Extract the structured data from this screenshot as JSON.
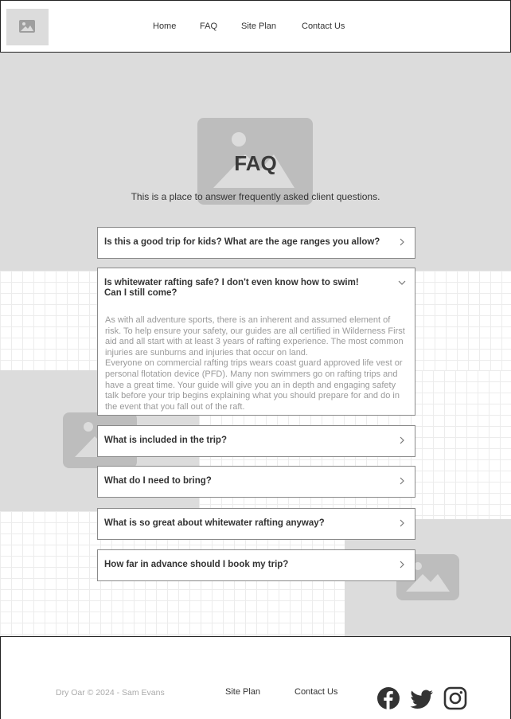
{
  "header": {
    "nav": [
      {
        "label": "Home"
      },
      {
        "label": "FAQ"
      },
      {
        "label": "Site Plan"
      },
      {
        "label": "Contact Us"
      }
    ]
  },
  "hero": {
    "title": "FAQ",
    "subtitle": "This is a place to answer frequently asked client questions."
  },
  "faq": [
    {
      "question": "Is this a good trip for kids? What are the age ranges you allow?",
      "expanded": false
    },
    {
      "question": "Is whitewater rafting safe? I don't even know how to swim! Can I still come?",
      "expanded": true,
      "answer_p1": "As with all adventure sports, there is an inherent and assumed element of risk. To help ensure your safety, our guides are all certified in Wilderness First aid and all start with at least 3 years of rafting experience. The most common injuries are sunburns and injuries that occur on land.",
      "answer_p2": "Everyone on commercial rafting trips wears coast guard approved life vest or personal flotation device (PFD). Many non swimmers go on rafting trips and have a great time. Your guide will give you an in depth and engaging safety talk before your trip begins explaining what you should prepare for and do in the event that you fall out of the raft."
    },
    {
      "question": "What is included in the trip?",
      "expanded": false
    },
    {
      "question": "What do I need to bring?",
      "expanded": false
    },
    {
      "question": "What is so great about whitewater rafting anyway?",
      "expanded": false
    },
    {
      "question": "How far in advance should I book my trip?",
      "expanded": false
    }
  ],
  "footer": {
    "copyright": "Dry Oar © 2024 - Sam Evans",
    "links": [
      {
        "label": "Site Plan"
      },
      {
        "label": "Contact Us"
      }
    ],
    "social": [
      "facebook-icon",
      "twitter-icon",
      "instagram-icon"
    ]
  },
  "colors": {
    "background_gray": "#dcdcdc",
    "placeholder_gray": "#bdbdbd",
    "text_dark": "#333333",
    "text_muted": "#9a9a9a"
  }
}
